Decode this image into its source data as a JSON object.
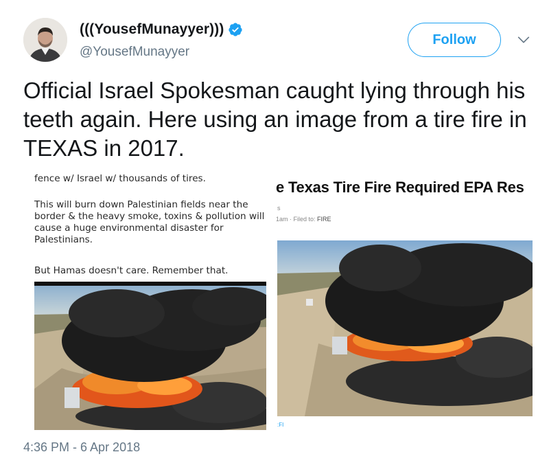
{
  "author": {
    "display_name": "(((YousefMunayyer)))",
    "handle": "@YousefMunayyer",
    "verified": true
  },
  "icons": {
    "verified": "verified-badge-icon",
    "menu": "chevron-down-icon"
  },
  "follow_label": "Follow",
  "tweet_text": "Official Israel Spokesman caught lying through his teeth again. Here using an image from a tire fire in TEXAS in 2017.",
  "media": {
    "left": {
      "line1": "fence w/ Israel w/ thousands of tires.",
      "line2": "This will burn down Palestinian fields near the border & the heavy smoke, toxins & pollution will cause a huge environmental disaster for Palestinians.",
      "line3": "But Hamas doesn't care. Remember that."
    },
    "right": {
      "headline": "e Texas Tire Fire Required EPA Res",
      "small": "s",
      "meta_time": "1am",
      "meta_filed": "Filed to:",
      "meta_tag": "FIRE",
      "caption": ":FI"
    }
  },
  "timestamp": "4:36 PM - 6 Apr 2018",
  "colors": {
    "accent": "#1da1f2",
    "text": "#14171a",
    "secondary": "#657786"
  }
}
